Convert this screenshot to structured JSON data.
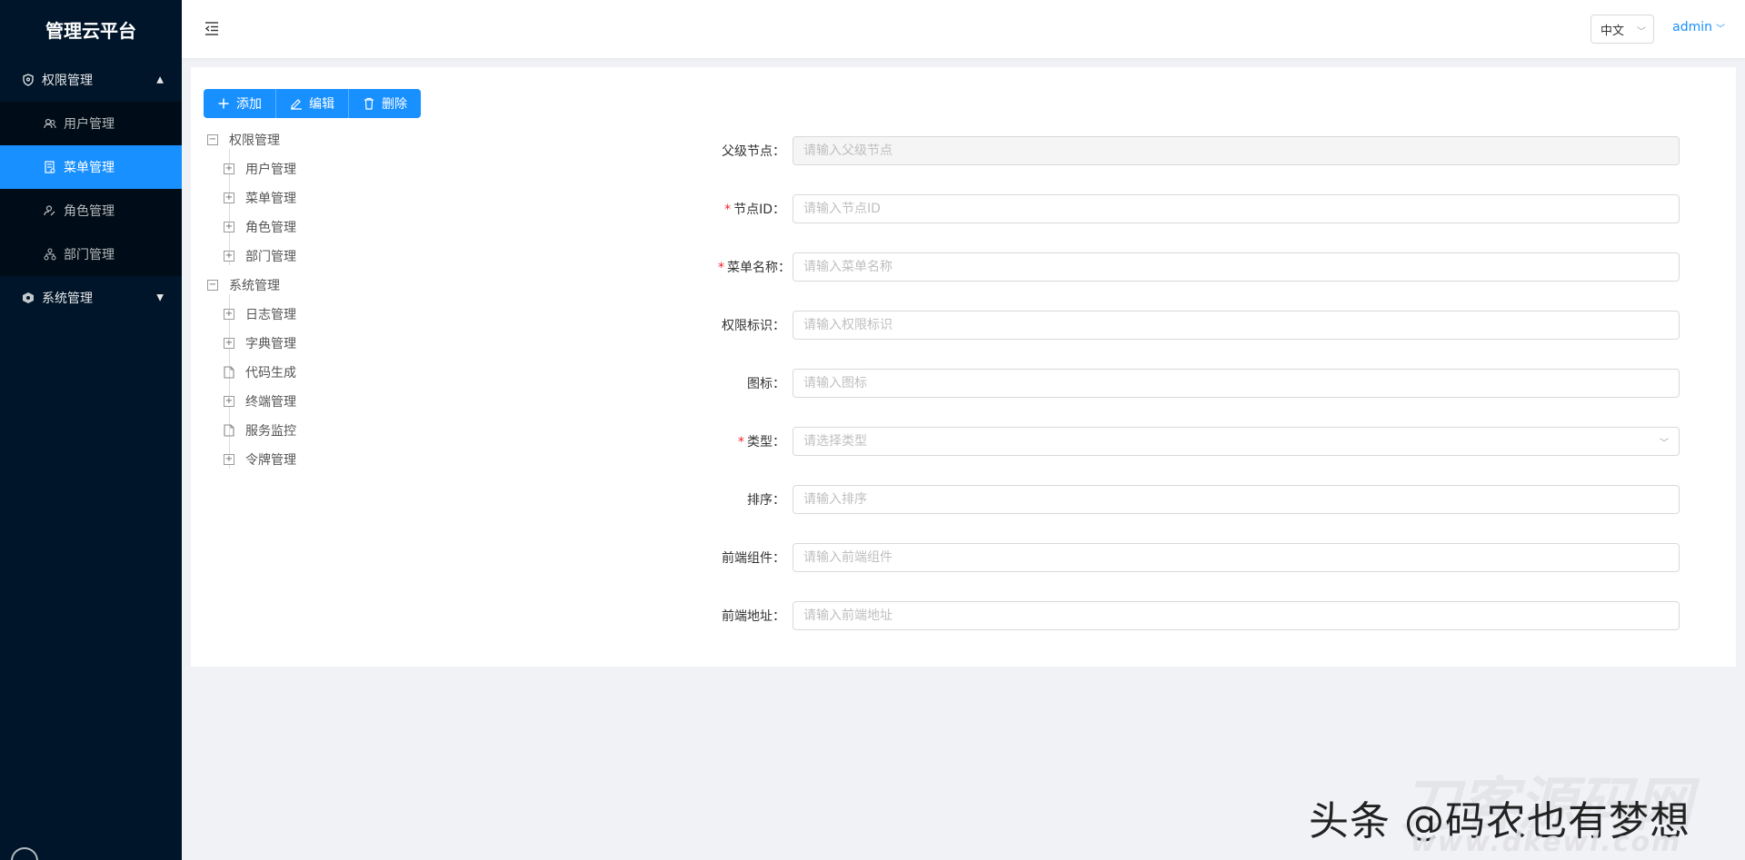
{
  "brand": {
    "title": "管理云平台"
  },
  "sidebar": {
    "groups": [
      {
        "label": "权限管理",
        "icon": "shield-icon",
        "expanded": true,
        "items": [
          {
            "label": "用户管理",
            "icon": "users-icon",
            "active": false
          },
          {
            "label": "菜单管理",
            "icon": "menu-doc-icon",
            "active": true
          },
          {
            "label": "角色管理",
            "icon": "role-icon",
            "active": false
          },
          {
            "label": "部门管理",
            "icon": "org-icon",
            "active": false
          }
        ]
      },
      {
        "label": "系统管理",
        "icon": "system-icon",
        "expanded": false
      }
    ]
  },
  "header": {
    "language": "中文",
    "user": "admin"
  },
  "toolbar": {
    "add_label": "添加",
    "edit_label": "编辑",
    "delete_label": "删除"
  },
  "tree": {
    "nodes": [
      {
        "label": "权限管理",
        "expanded": true,
        "children": [
          {
            "label": "用户管理",
            "leaf": false
          },
          {
            "label": "菜单管理",
            "leaf": false
          },
          {
            "label": "角色管理",
            "leaf": false
          },
          {
            "label": "部门管理",
            "leaf": false
          }
        ]
      },
      {
        "label": "系统管理",
        "expanded": true,
        "children": [
          {
            "label": "日志管理",
            "leaf": false
          },
          {
            "label": "字典管理",
            "leaf": false
          },
          {
            "label": "代码生成",
            "leaf": true
          },
          {
            "label": "终端管理",
            "leaf": false
          },
          {
            "label": "服务监控",
            "leaf": true
          },
          {
            "label": "令牌管理",
            "leaf": false
          }
        ]
      }
    ]
  },
  "form": {
    "parent": {
      "label": "父级节点：",
      "placeholder": "请输入父级节点",
      "value": ""
    },
    "node_id": {
      "label": "节点ID：",
      "placeholder": "请输入节点ID",
      "value": ""
    },
    "menu_name": {
      "label": "菜单名称：",
      "placeholder": "请输入菜单名称",
      "value": ""
    },
    "perm": {
      "label": "权限标识：",
      "placeholder": "请输入权限标识",
      "value": ""
    },
    "icon": {
      "label": "图标：",
      "placeholder": "请输入图标",
      "value": ""
    },
    "type": {
      "label": "类型：",
      "placeholder": "请选择类型",
      "value": ""
    },
    "sort": {
      "label": "排序：",
      "placeholder": "请输入排序",
      "value": ""
    },
    "component": {
      "label": "前端组件：",
      "placeholder": "请输入前端组件",
      "value": ""
    },
    "path": {
      "label": "前端地址：",
      "placeholder": "请输入前端地址",
      "value": ""
    }
  },
  "watermark": {
    "author": "头条 @码农也有梦想",
    "site": "刀客源码网",
    "url": "www.dkewl.com"
  },
  "colors": {
    "sidebar_bg": "#001529",
    "accent": "#1890ff",
    "required": "#f5222d"
  }
}
